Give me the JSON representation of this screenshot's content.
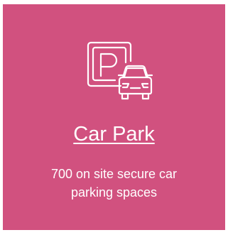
{
  "card": {
    "background": "#d1517f",
    "text_color": "#ffffff",
    "icon": "parking-car-icon",
    "title": "Car Park",
    "description_line1": "700 on site secure car",
    "description_line2": "parking spaces"
  }
}
